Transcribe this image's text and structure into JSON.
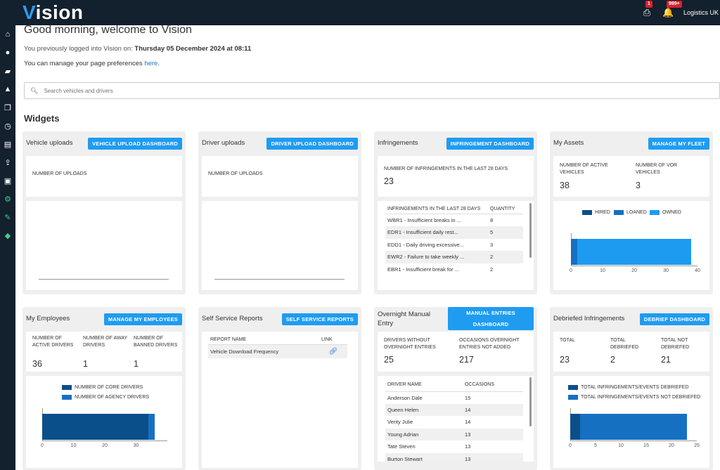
{
  "app": {
    "logo_first": "V",
    "logo_rest": "ision",
    "org": "Logistics UK",
    "print_badge": "1",
    "bell_badge": "999+"
  },
  "sidebar": {
    "items": [
      "home-icon",
      "user-icon",
      "truck-icon",
      "warning-icon",
      "documents-icon",
      "clock-icon",
      "files-icon",
      "upload-icon",
      "image-icon",
      "cogs-icon",
      "wrench-icon",
      "ticket-icon"
    ]
  },
  "header": {
    "greeting": "Good morning, welcome to Vision",
    "last_login_prefix": "You previously logged into Vision on:",
    "last_login": "Thursday 05 December 2024 at 08:11",
    "prefs_text": "You can manage your page preferences",
    "prefs_link": "here",
    "prefs_end": "."
  },
  "search": {
    "placeholder": "Search vehicles and drivers"
  },
  "widgets_title": "Widgets",
  "vehicle_uploads": {
    "title": "Vehicle uploads",
    "button": "VEHICLE UPLOAD DASHBOARD",
    "label": "NUMBER OF UPLOADS"
  },
  "driver_uploads": {
    "title": "Driver uploads",
    "button": "DRIVER UPLOAD DASHBOARD",
    "label": "NUMBER OF UPLOADS"
  },
  "infringements": {
    "title": "Infringements",
    "button": "INFRINGEMENT DASHBOARD",
    "label": "NUMBER OF INFRINGEMENTS IN THE LAST 28 DAYS",
    "count": "23",
    "col1": "INFRINGEMENTS IN THE LAST 28 DAYS",
    "col2": "QUANTITY",
    "rows": [
      {
        "name": "WBR1 - Insufficient breaks in ...",
        "qty": "8"
      },
      {
        "name": "EDR1 - Insufficient daily rest...",
        "qty": "5"
      },
      {
        "name": "EDD1 - Daily driving excessive...",
        "qty": "3"
      },
      {
        "name": "EWR2 - Failure to take weekly ...",
        "qty": "2"
      },
      {
        "name": "EBR1 - Insufficient break for ...",
        "qty": "2"
      }
    ]
  },
  "assets": {
    "title": "My Assets",
    "button": "MANAGE MY FLEET",
    "active_label": "NUMBER OF ACTIVE VEHICLES",
    "active": "38",
    "vor_label": "NUMBER OF VOR VEHICLES",
    "vor": "3",
    "legend": [
      "HIRED",
      "LOANED",
      "OWNED"
    ],
    "colors": {
      "hired": "#0b4f8a",
      "loaned": "#1670c2",
      "owned": "#1d9bf0"
    }
  },
  "employees": {
    "title": "My Employees",
    "button": "MANAGE MY EMPLOYEES",
    "active_label": "NUMBER OF ACTIVE DRIVERS",
    "active": "36",
    "away_label": "NUMBER OF AWAY DRIVERS",
    "away": "1",
    "banned_label": "NUMBER OF BANNED DRIVERS",
    "banned": "1",
    "legend": [
      "NUMBER OF CORE DRIVERS",
      "NUMBER OF AGENCY DRIVERS"
    ]
  },
  "reports": {
    "title": "Self Service Reports",
    "button": "SELF SERVICE REPORTS",
    "col1": "REPORT NAME",
    "col2": "LINK",
    "rows": [
      {
        "name": "Vehicle Download Frequency",
        "link": "link-icon"
      }
    ]
  },
  "overnight": {
    "title": "Overnight Manual Entry",
    "button": "MANUAL ENTRIES DASHBOARD",
    "without_label": "DRIVERS WITHOUT OVERNIGHT ENTRIES",
    "without": "25",
    "notadded_label": "OCCASIONS OVERNIGHT ENTRIES NOT ADDED",
    "notadded": "217",
    "col1": "DRIVER NAME",
    "col2": "OCCASIONS",
    "rows": [
      {
        "name": "Anderson Dale",
        "occ": "15"
      },
      {
        "name": "Queen Helen",
        "occ": "14"
      },
      {
        "name": "Verity Julie",
        "occ": "14"
      },
      {
        "name": "Young Adrian",
        "occ": "13"
      },
      {
        "name": "Tate Steven",
        "occ": "13"
      },
      {
        "name": "Burton Stewart",
        "occ": "13"
      }
    ]
  },
  "debriefed": {
    "title": "Debriefed Infringements",
    "button": "DEBRIEF DASHBOARD",
    "total_label": "TOTAL",
    "total": "23",
    "deb_label": "TOTAL DEBRIEFED",
    "deb": "2",
    "notdeb_label": "TOTAL NOT DEBRIEFED",
    "notdeb": "21",
    "legend": [
      "TOTAL INFRINGEMENTS/EVENTS DEBRIEFED",
      "TOTAL INFRINGEMENTS/EVENTS NOT DEBRIEFED"
    ]
  },
  "chart_data": [
    {
      "type": "bar",
      "orientation": "horizontal",
      "stacked": true,
      "title": "My Assets",
      "series": [
        {
          "name": "HIRED",
          "values": [
            0
          ]
        },
        {
          "name": "LOANED",
          "values": [
            2
          ]
        },
        {
          "name": "OWNED",
          "values": [
            36
          ]
        }
      ],
      "xlim": [
        0,
        40
      ],
      "xticks": [
        0,
        10,
        20,
        30,
        40
      ]
    },
    {
      "type": "bar",
      "orientation": "horizontal",
      "stacked": true,
      "title": "My Employees",
      "series": [
        {
          "name": "NUMBER OF CORE DRIVERS",
          "values": [
            34
          ]
        },
        {
          "name": "NUMBER OF AGENCY DRIVERS",
          "values": [
            2
          ]
        }
      ],
      "xlim": [
        0,
        40
      ],
      "xticks": [
        0,
        10,
        20,
        30
      ]
    },
    {
      "type": "bar",
      "orientation": "horizontal",
      "stacked": true,
      "title": "Debriefed Infringements",
      "series": [
        {
          "name": "TOTAL INFRINGEMENTS/EVENTS DEBRIEFED",
          "values": [
            2
          ]
        },
        {
          "name": "TOTAL INFRINGEMENTS/EVENTS NOT DEBRIEFED",
          "values": [
            21
          ]
        }
      ],
      "xlim": [
        0,
        25
      ],
      "xticks": [
        0,
        5,
        10,
        15,
        20,
        25
      ]
    }
  ]
}
